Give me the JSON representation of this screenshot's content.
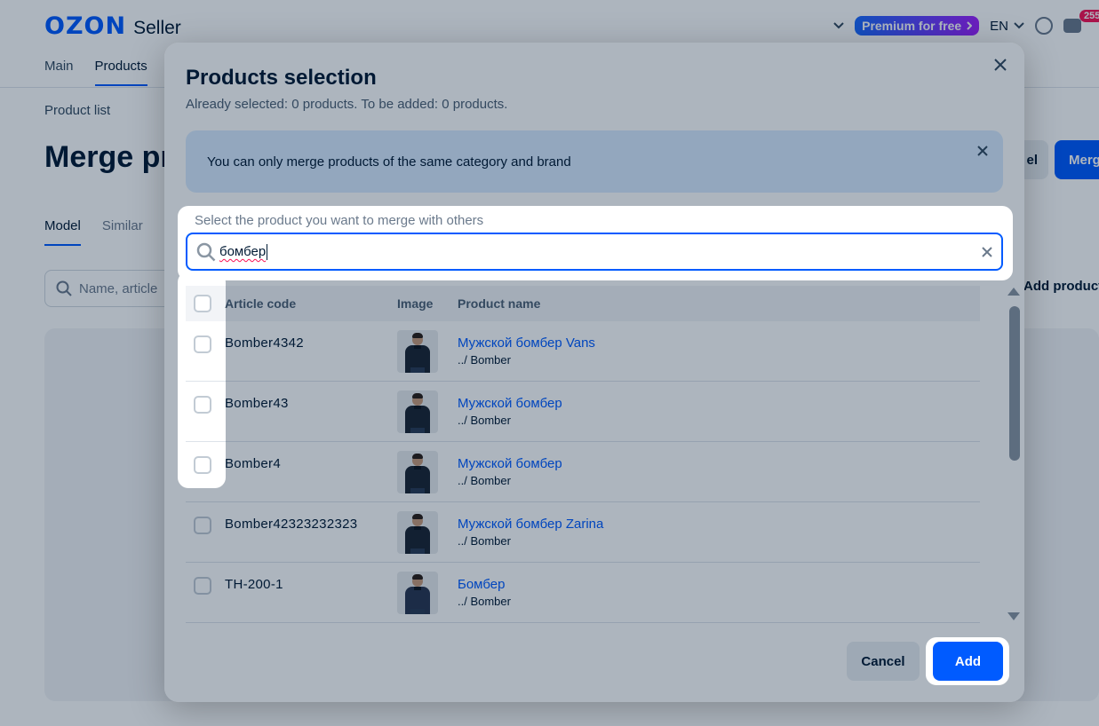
{
  "app": {
    "logo_brand": "OZON",
    "logo_product": "Seller",
    "premium_label": "Premium for free",
    "language": "EN",
    "notification_count": "255"
  },
  "nav": {
    "items": [
      "Main",
      "Products"
    ]
  },
  "page": {
    "breadcrumb": "Product list",
    "title": "Merge pr",
    "tabs": [
      "Model",
      "Similar"
    ],
    "search_placeholder": "Name, article",
    "cancel_label": "el",
    "merge_label": "Merg",
    "add_products_label": "Add product"
  },
  "modal": {
    "title": "Products selection",
    "subtitle": "Already selected: 0 products. To be added: 0 products.",
    "info_text": "You can only merge products of the same category and brand",
    "field_label": "Select the product you want to merge with others",
    "search_value": "бомбер",
    "columns": {
      "article": "Article code",
      "image": "Image",
      "name": "Product name"
    },
    "rows": [
      {
        "code": "Bomber4342",
        "name": "Мужской бомбер Vans",
        "category": "../ Bomber"
      },
      {
        "code": "Bomber43",
        "name": "Мужской бомбер",
        "category": "../ Bomber"
      },
      {
        "code": "Bomber4",
        "name": "Мужской бомбер",
        "category": "../ Bomber"
      },
      {
        "code": "Bomber42323232323",
        "name": "Мужской бомбер Zarina",
        "category": "../ Bomber"
      },
      {
        "code": "TH-200-1",
        "name": "Бомбер",
        "category": "../ Bomber"
      }
    ],
    "cancel_label": "Cancel",
    "add_label": "Add"
  },
  "colors": {
    "accent": "#005bff",
    "info_bg": "#d9ebff",
    "text": "#001a34"
  }
}
